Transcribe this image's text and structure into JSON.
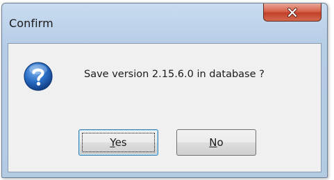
{
  "window": {
    "title": "Confirm"
  },
  "titlebar": {
    "close_icon": "close-x-icon"
  },
  "dialog": {
    "icon": "question-icon",
    "message": "Save version 2.15.6.0 in database ?"
  },
  "buttons": {
    "yes": {
      "accel": "Y",
      "rest": "es"
    },
    "no": {
      "accel": "N",
      "rest": "o"
    }
  },
  "colors": {
    "close_button": "#c9442c",
    "question_icon": "#1d5fb4",
    "default_button_border": "#3c7fb1"
  }
}
